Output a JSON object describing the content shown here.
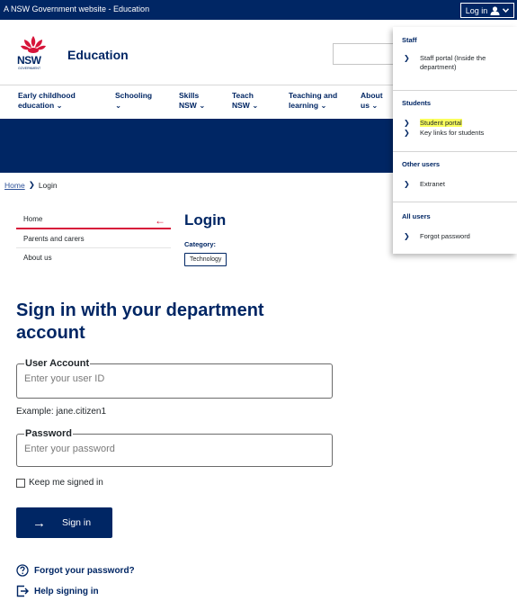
{
  "topbar": {
    "gov_text": "A NSW Government website - Education",
    "login_label": "Log in",
    "user_icon": "user-icon",
    "chevron_icon": "chevron-down-icon"
  },
  "header": {
    "logo_text": "NSW",
    "logo_subtext": "GOVERNMENT",
    "brand": "Education"
  },
  "nav": {
    "items": [
      {
        "label": "Early childhood education ⌄"
      },
      {
        "label": "Schooling ⌄"
      },
      {
        "label": "Skills NSW ⌄"
      },
      {
        "label": "Teach NSW ⌄"
      },
      {
        "label": "Teaching and learning ⌄"
      },
      {
        "label": "About us ⌄"
      }
    ]
  },
  "breadcrumb": {
    "home": "Home",
    "separator": "❯",
    "current": "Login"
  },
  "sidenav": {
    "items": [
      {
        "label": "Home",
        "arrow": "←"
      },
      {
        "label": "Parents and carers"
      },
      {
        "label": "About us"
      }
    ]
  },
  "page": {
    "title": "Login",
    "category_label": "Category:",
    "category_tag": "Technology"
  },
  "signin": {
    "heading": "Sign in with your department account",
    "user_account_legend": "User Account",
    "user_account_placeholder": "Enter your user ID",
    "user_account_value": "",
    "example": "Example: jane.citizen1",
    "password_legend": "Password",
    "password_placeholder": "Enter your password",
    "password_value": "",
    "keep_signed_in": "Keep me signed in",
    "keep_signed_in_checked": false,
    "button_label": "Sign in",
    "button_arrow": "→",
    "forgot_password": "Forgot your password?",
    "help_signing_in": "Help signing in"
  },
  "dropdown": {
    "sections": [
      {
        "title": "Staff",
        "items": [
          {
            "label": "Staff portal (Inside the department)"
          }
        ]
      },
      {
        "title": "Students",
        "items": [
          {
            "label": "Student portal",
            "highlighted": true
          },
          {
            "label": "Key links for students"
          }
        ]
      },
      {
        "title": "Other users",
        "items": [
          {
            "label": "Extranet"
          }
        ]
      },
      {
        "title": "All users",
        "items": [
          {
            "label": "Forgot password"
          }
        ]
      }
    ],
    "chevron": "❯"
  },
  "colors": {
    "brand_navy": "#002664",
    "accent_red": "#d7153a",
    "highlight_yellow": "#faff5c",
    "link_blue": "#2e5299"
  }
}
